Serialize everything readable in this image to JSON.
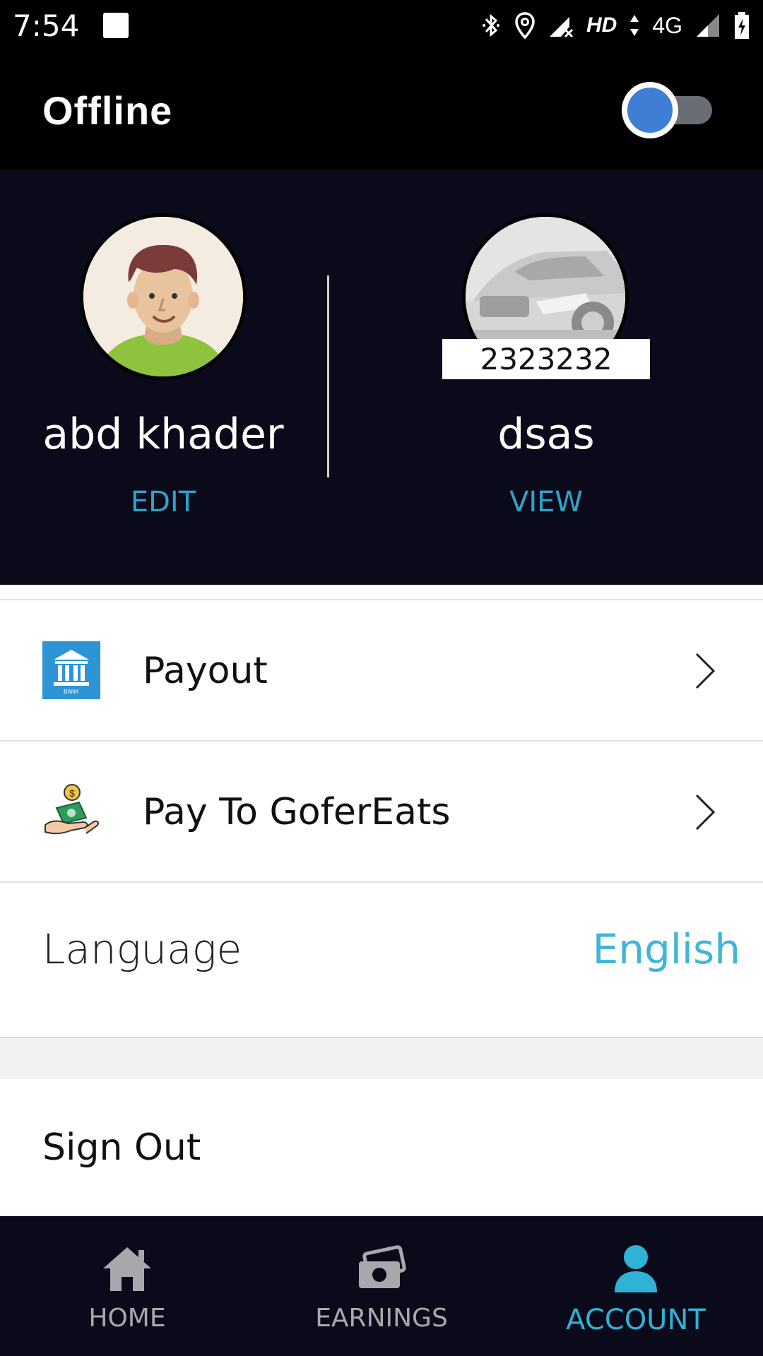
{
  "status_bar": {
    "time": "7:54",
    "hd": "HD",
    "network": "4G"
  },
  "header": {
    "title": "Offline",
    "toggle_state": "off"
  },
  "profile": {
    "user_name": "abd khader",
    "user_action": "EDIT",
    "vehicle_plate": "2323232",
    "vehicle_name": "dsas",
    "vehicle_action": "VIEW"
  },
  "menu": {
    "payout_label": "Payout",
    "pay_to_label": "Pay To GoferEats",
    "language_label": "Language",
    "language_value": "English",
    "sign_out_label": "Sign Out"
  },
  "bottom_nav": {
    "items": [
      {
        "label": "HOME",
        "icon": "home-icon",
        "active": false
      },
      {
        "label": "EARNINGS",
        "icon": "earnings-icon",
        "active": false
      },
      {
        "label": "ACCOUNT",
        "icon": "account-icon",
        "active": true
      }
    ]
  },
  "colors": {
    "accent": "#2eb3d6",
    "dark_bg": "#0b0a1b",
    "toggle_knob": "#3e7ed4"
  }
}
